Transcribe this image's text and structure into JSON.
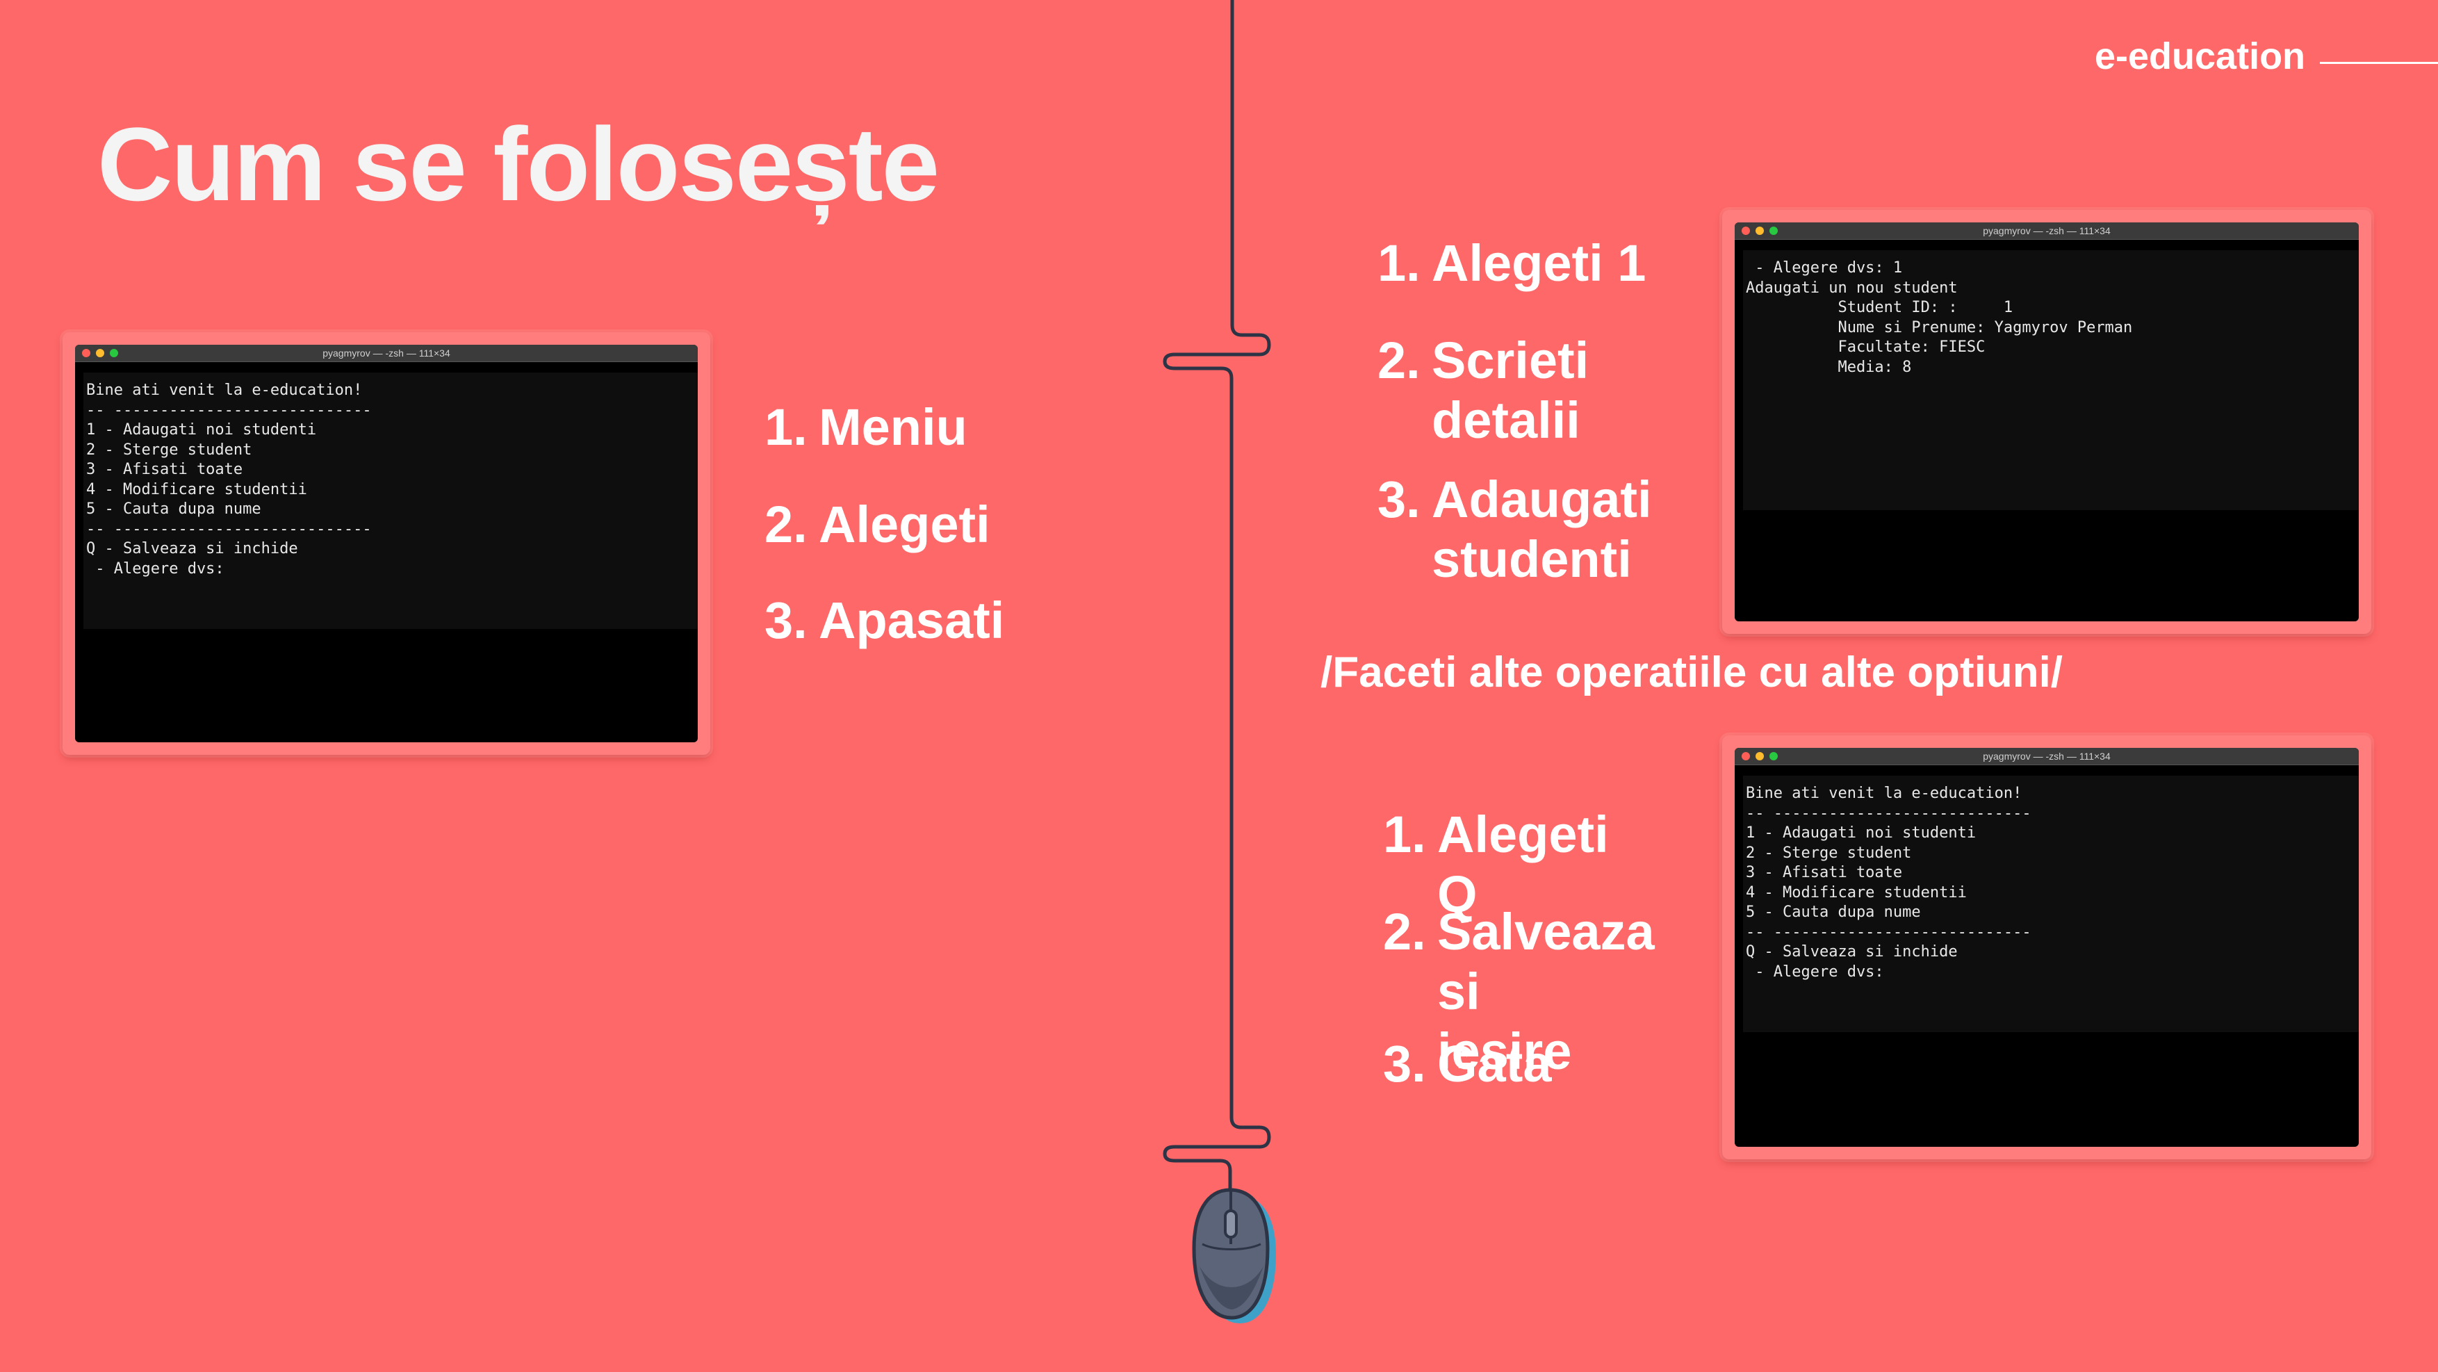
{
  "brand": "e-education",
  "title": "Cum se folosește",
  "menu_steps": [
    "Meniu",
    "Alegeti",
    "Apasati"
  ],
  "add_steps": [
    "Alegeti 1",
    "Scrieti\ndetalii",
    "Adaugati\nstudenti"
  ],
  "note": "/Faceti alte operatiile cu alte optiuni/",
  "quit_steps": [
    "Alegeti Q",
    "Salveaza si\niesire",
    "Gata"
  ],
  "term_title": "pyagmyrov — -zsh — 111×34",
  "menu_terminal": {
    "lines": [
      "Bine ati venit la e-education!",
      "-- ----------------------------",
      "1 - Adaugati noi studenti",
      "2 - Sterge student",
      "3 - Afisati toate",
      "4 - Modificare studentii",
      "5 - Cauta dupa nume",
      "-- ----------------------------",
      "Q - Salveaza si inchide",
      "",
      " - Alegere dvs:"
    ]
  },
  "add_terminal": {
    "lines": [
      " - Alegere dvs: 1",
      "Adaugati un nou student",
      "",
      "          Student ID: :     1",
      "          Nume si Prenume: Yagmyrov Perman",
      "          Facultate: FIESC",
      "          Media: 8"
    ]
  },
  "colors": {
    "background": "#ff6868",
    "text": "#ffffff",
    "terminal": "#000000",
    "cable": "#2c3445"
  },
  "icons": [
    "computer-mouse-icon"
  ]
}
